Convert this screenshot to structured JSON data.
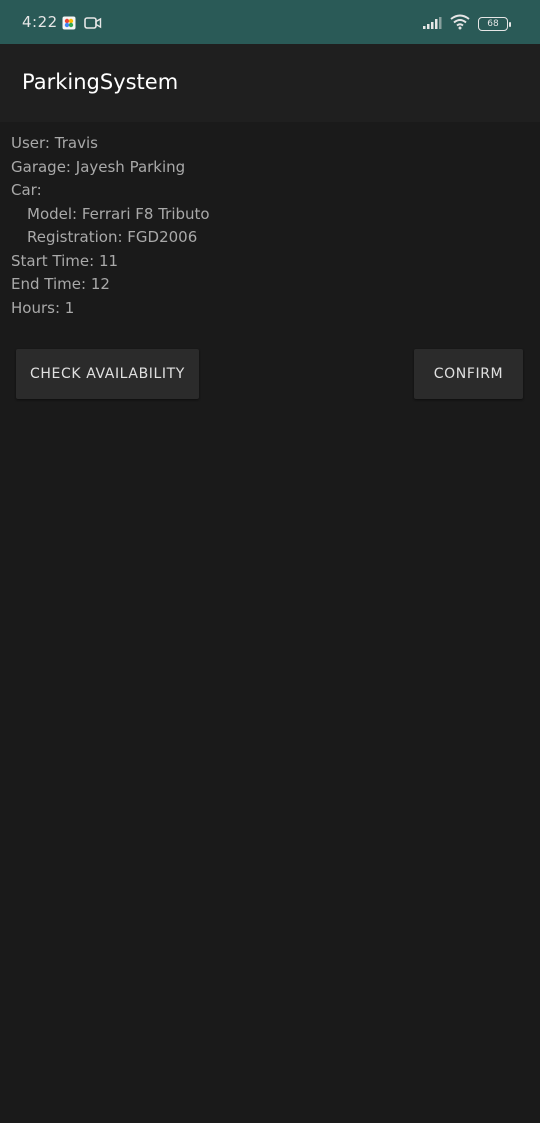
{
  "status_bar": {
    "time": "4:22",
    "battery": "68",
    "icons": [
      "photos-icon",
      "video-camera-icon",
      "signal-icon",
      "wifi-icon",
      "battery-icon"
    ]
  },
  "app_bar": {
    "title": "ParkingSystem"
  },
  "details": {
    "user_label": "User:",
    "user_value": "Travis",
    "garage_label": "Garage:",
    "garage_value": "Jayesh Parking",
    "car_label": "Car:",
    "model_label": "Model:",
    "model_value": "Ferrari F8 Tributo",
    "registration_label": "Registration:",
    "registration_value": "FGD2006",
    "start_label": "Start Time:",
    "start_value": "11",
    "end_label": "End Time:",
    "end_value": "12",
    "hours_label": "Hours:",
    "hours_value": "1"
  },
  "buttons": {
    "check_availability": "CHECK AVAILABILITY",
    "confirm": "CONFIRM"
  }
}
